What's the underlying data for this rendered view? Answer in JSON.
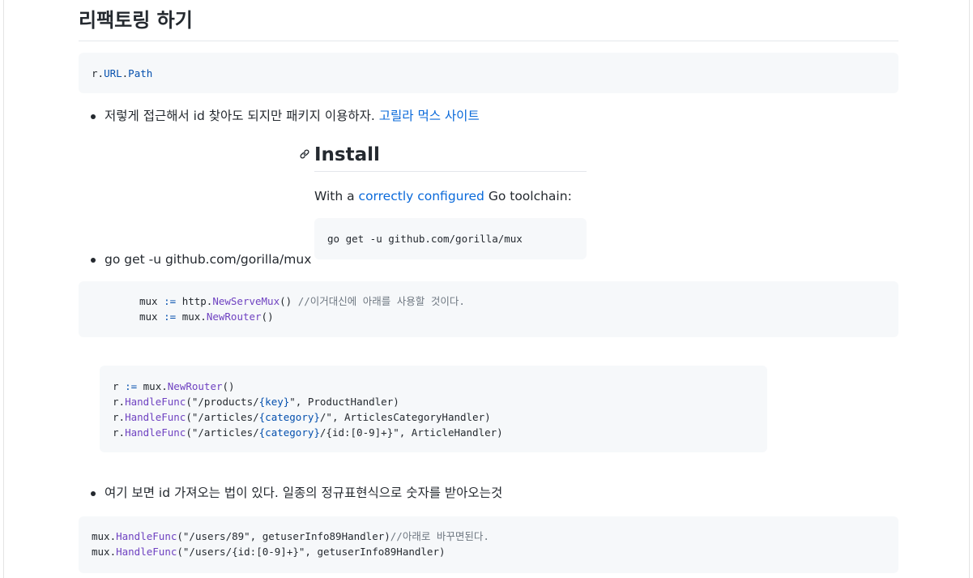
{
  "heading": "리팩토링 하기",
  "code1": {
    "r": "r.",
    "url": "URL",
    "dot": ".",
    "path": "Path"
  },
  "bullet1": {
    "text": "저렇게 접근해서 id 찾아도 되지만 패키지 이용하자. ",
    "link": "고릴라 먹스 사이트"
  },
  "embed": {
    "anchor_icon": "link-icon",
    "title": "Install",
    "pre_text": "With a ",
    "link": "correctly configured",
    "post_text": " Go toolchain:",
    "command": "go get -u github.com/gorilla/mux"
  },
  "bullet2": "go get -u github.com/gorilla/mux",
  "code2": {
    "l1_a": "mux ",
    "l1_op": ":=",
    "l1_b": " http.",
    "l1_fn": "NewServeMux",
    "l1_c": "() ",
    "l1_cmt": "//이거대신에 아래를 사용할 것이다.",
    "l2_a": "mux ",
    "l2_op": ":=",
    "l2_b": " mux.",
    "l2_fn": "NewRouter",
    "l2_c": "()"
  },
  "code3": {
    "l1_a": "r ",
    "l1_op": ":=",
    "l1_b": " mux.",
    "l1_fn": "NewRouter",
    "l1_c": "()",
    "l2_a": "r.",
    "l2_fn": "HandleFunc",
    "l2_b": "(\"/products/",
    "l2_key": "{key}",
    "l2_c": "\", ProductHandler)",
    "l3_a": "r.",
    "l3_fn": "HandleFunc",
    "l3_b": "(\"/articles/",
    "l3_key": "{category}",
    "l3_c": "/\", ArticlesCategoryHandler)",
    "l4_a": "r.",
    "l4_fn": "HandleFunc",
    "l4_b": "(\"/articles/",
    "l4_key": "{category}",
    "l4_c": "/{id:[0-9]+}\", ArticleHandler)"
  },
  "bullet3": "여기 보면 id 가져오는 법이 있다. 일종의 정규표현식으로 숫자를 받아오는것",
  "code4": {
    "l1_a": "mux.",
    "l1_fn": "HandleFunc",
    "l1_b": "(\"/users/89\", getuserInfo89Handler)",
    "l1_cmt": "//아래로 바꾸면된다.",
    "l2_a": "mux.",
    "l2_fn": "HandleFunc",
    "l2_b": "(\"/users/{id:[0-9]+}\", getuserInfo89Handler)"
  }
}
